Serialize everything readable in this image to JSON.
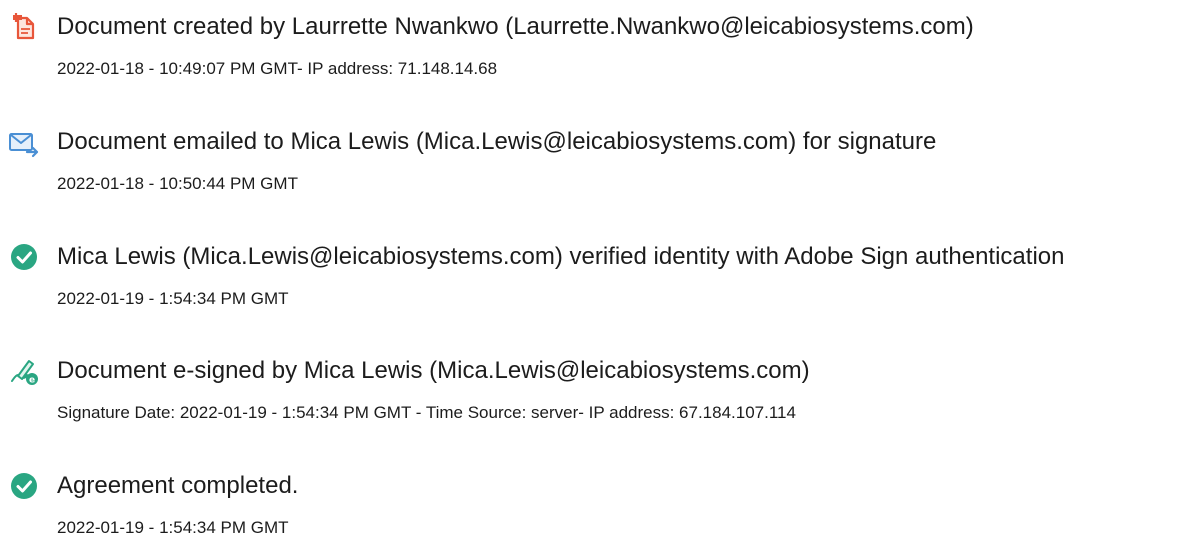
{
  "audit_events": [
    {
      "icon": "document-created-icon",
      "icon_color": "#e8563a",
      "title": "Document created by Laurrette Nwankwo (Laurrette.Nwankwo@leicabiosystems.com)",
      "detail": "2022-01-18 - 10:49:07 PM GMT- IP address: 71.148.14.68"
    },
    {
      "icon": "email-sent-icon",
      "icon_color": "#4a8fd4",
      "title": "Document emailed to Mica Lewis (Mica.Lewis@leicabiosystems.com) for signature",
      "detail": "2022-01-18 - 10:50:44 PM GMT"
    },
    {
      "icon": "verified-check-icon",
      "icon_color": "#2aa682",
      "title": "Mica Lewis (Mica.Lewis@leicabiosystems.com) verified identity with Adobe Sign authentication",
      "detail": "2022-01-19 - 1:54:34 PM GMT"
    },
    {
      "icon": "e-signed-pen-icon",
      "icon_color": "#2aa682",
      "title": "Document e-signed by Mica Lewis (Mica.Lewis@leicabiosystems.com)",
      "detail": "Signature Date: 2022-01-19 - 1:54:34 PM GMT - Time Source: server- IP address: 67.184.107.114"
    },
    {
      "icon": "completed-check-icon",
      "icon_color": "#2aa682",
      "title": "Agreement completed.",
      "detail": "2022-01-19 - 1:54:34 PM GMT"
    }
  ]
}
